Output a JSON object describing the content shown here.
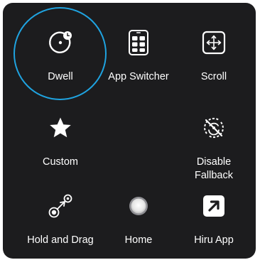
{
  "menu": {
    "items": [
      {
        "id": "dwell",
        "label": "Dwell",
        "icon": "dwell-timer-icon",
        "selected": true
      },
      {
        "id": "app-switcher",
        "label": "App Switcher",
        "icon": "app-switcher-icon"
      },
      {
        "id": "scroll",
        "label": "Scroll",
        "icon": "scroll-arrows-icon"
      },
      {
        "id": "custom",
        "label": "Custom",
        "icon": "star-icon"
      },
      {
        "id": "disable-fallback",
        "label": "Disable\nFallback",
        "icon": "disable-fallback-icon"
      },
      {
        "id": "hold-and-drag",
        "label": "Hold and Drag",
        "icon": "hold-and-drag-icon"
      },
      {
        "id": "home",
        "label": "Home",
        "icon": "home-button-icon"
      },
      {
        "id": "hiru-app",
        "label": "Hiru App",
        "icon": "arrow-up-right-icon"
      }
    ]
  },
  "colors": {
    "panel_background": "#1c1c1e",
    "selection_ring": "#1fa3e0",
    "foreground": "#ffffff"
  }
}
